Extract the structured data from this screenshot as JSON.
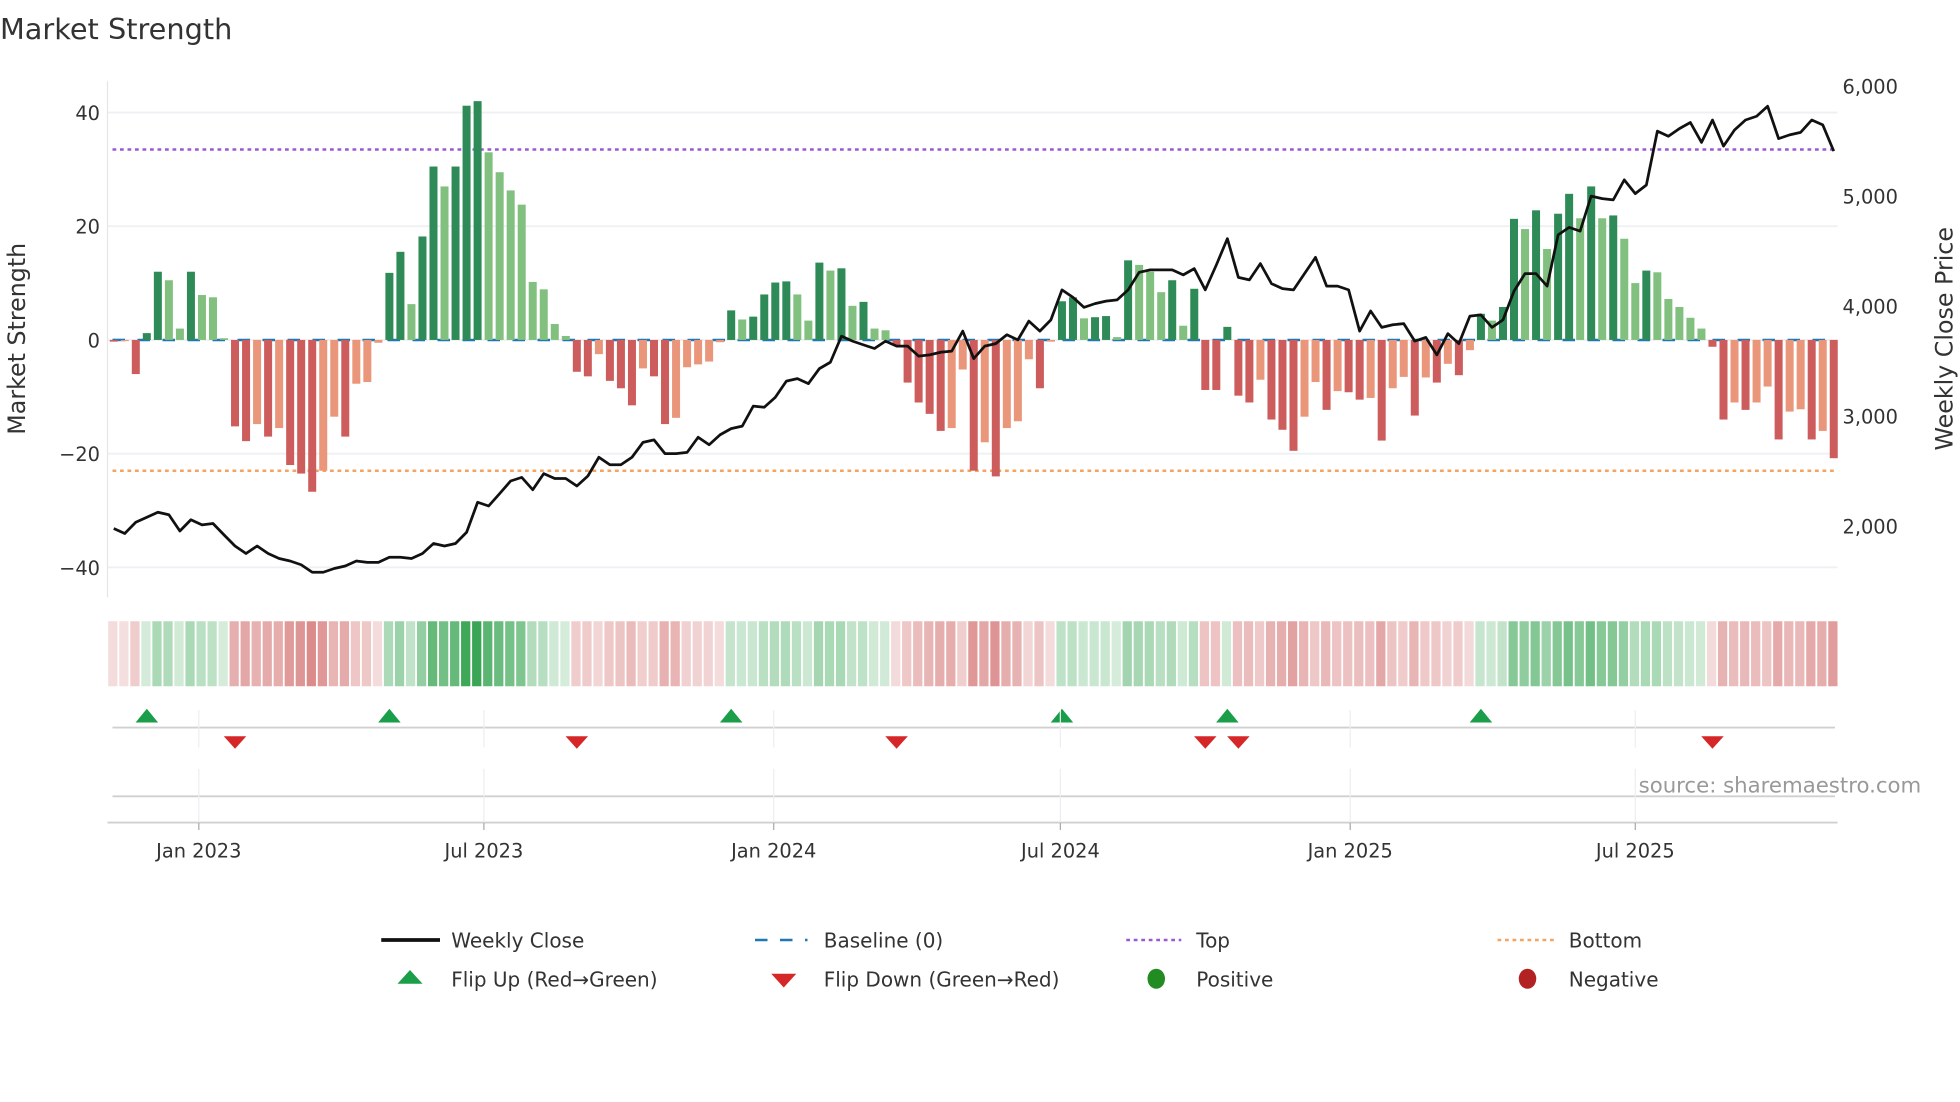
{
  "chart_data": {
    "type": "bar",
    "title": "Market Strength",
    "ylabel": "Market Strength",
    "y2label": "Weekly Close Price",
    "ylim": [
      -45.3,
      45.5
    ],
    "y2lim": [
      1350,
      6045
    ],
    "yticks": [
      40,
      20,
      0,
      -20,
      -40
    ],
    "yticklabels": [
      "40",
      "20",
      "0",
      "−20",
      "−40"
    ],
    "y2ticks": [
      6000,
      5000,
      4000,
      3000,
      2000
    ],
    "y2ticklabels": [
      "6,000",
      "5,000",
      "4,000",
      "3,000",
      "2,000"
    ],
    "x_start": "2022-11-08",
    "x_freq": "weekly",
    "xticks": [
      "2023-01-01",
      "2023-07-01",
      "2024-01-01",
      "2024-07-01",
      "2025-01-01",
      "2025-07-01"
    ],
    "xticklabels": [
      "Jan 2023",
      "Jul 2023",
      "Jan 2024",
      "Jul 2024",
      "Jan 2025",
      "Jul 2025"
    ],
    "top_level": 33.5,
    "bottom_level": -23,
    "baseline": 0,
    "strength": [
      -0.3,
      -0.2,
      -6,
      1.2,
      12,
      10.5,
      2,
      12,
      7.9,
      7.5,
      0.3,
      -15.2,
      -17.8,
      -14.8,
      -17,
      -15.5,
      -22,
      -23.5,
      -26.7,
      -23,
      -13.5,
      -17,
      -7.7,
      -7.4,
      -0.5,
      11.8,
      15.5,
      6.3,
      18.2,
      30.5,
      27,
      30.5,
      41.2,
      42,
      33,
      29.5,
      26.3,
      23.8,
      10.2,
      8.9,
      2.8,
      0.7,
      -5.6,
      -6.4,
      -2.5,
      -7.2,
      -8.5,
      -11.5,
      -5,
      -6.4,
      -14.8,
      -13.7,
      -4.8,
      -4.3,
      -3.8,
      -0.4,
      5.2,
      3.6,
      4.1,
      8,
      10.1,
      10.3,
      8,
      3.4,
      13.6,
      12.2,
      12.6,
      6,
      6.7,
      2,
      1.7,
      -1,
      -7.5,
      -11,
      -13,
      -16,
      -15.5,
      -5.2,
      -23,
      -18,
      -24,
      -15.5,
      -14.3,
      -3.4,
      -8.5,
      -0.3,
      6.8,
      7.5,
      3.8,
      4,
      4.2,
      0.5,
      14,
      13.2,
      12,
      8.4,
      10.5,
      2.5,
      9,
      -8.8,
      -8.8,
      2.3,
      -9.8,
      -11,
      -7,
      -14,
      -15.8,
      -19.5,
      -13.5,
      -7.4,
      -12.3,
      -9,
      -9.2,
      -10.5,
      -10.2,
      -17.7,
      -8.5,
      -6.5,
      -13.3,
      -6.6,
      -7.5,
      -4.2,
      -6.2,
      -1.8,
      4.6,
      3.4,
      5.8,
      21.3,
      19.5,
      22.8,
      16,
      22.2,
      25.7,
      21.4,
      27,
      21.4,
      21.9,
      17.8,
      10,
      12.2,
      11.9,
      7.2,
      5.8,
      3.9,
      2,
      -1.2,
      -14,
      -11,
      -12.3,
      -11,
      -8.2,
      -17.5,
      -12.6,
      -12.2,
      -17.5,
      -16,
      -20.8
    ],
    "weekly_close": [
      1977,
      1932,
      2034,
      2080,
      2125,
      2102,
      1955,
      2057,
      2011,
      2023,
      1920,
      1818,
      1750,
      1818,
      1750,
      1705,
      1682,
      1648,
      1580,
      1580,
      1614,
      1636,
      1682,
      1670,
      1670,
      1716,
      1716,
      1705,
      1750,
      1841,
      1818,
      1841,
      1943,
      2216,
      2182,
      2295,
      2409,
      2443,
      2330,
      2477,
      2432,
      2432,
      2364,
      2455,
      2625,
      2557,
      2557,
      2625,
      2761,
      2784,
      2659,
      2659,
      2670,
      2807,
      2739,
      2830,
      2886,
      2909,
      3091,
      3080,
      3170,
      3318,
      3341,
      3295,
      3432,
      3489,
      3727,
      3682,
      3648,
      3614,
      3682,
      3636,
      3636,
      3545,
      3557,
      3580,
      3591,
      3773,
      3523,
      3636,
      3659,
      3739,
      3693,
      3864,
      3773,
      3875,
      4148,
      4080,
      3989,
      4023,
      4045,
      4057,
      4148,
      4307,
      4330,
      4330,
      4330,
      4284,
      4341,
      4148,
      4375,
      4614,
      4261,
      4239,
      4386,
      4205,
      4159,
      4148,
      4295,
      4443,
      4182,
      4182,
      4148,
      3773,
      3955,
      3807,
      3830,
      3841,
      3682,
      3716,
      3557,
      3750,
      3659,
      3909,
      3920,
      3807,
      3875,
      4136,
      4295,
      4295,
      4182,
      4648,
      4716,
      4682,
      5000,
      4977,
      4966,
      5148,
      5023,
      5102,
      5591,
      5545,
      5614,
      5670,
      5489,
      5693,
      5455,
      5602,
      5693,
      5727,
      5818,
      5523,
      5557,
      5580,
      5693,
      5648,
      5409
    ],
    "flip_up_weeks": [
      3,
      25,
      56,
      86,
      101,
      124
    ],
    "flip_down_weeks": [
      11,
      42,
      71,
      99,
      102,
      145
    ],
    "legend": {
      "placement": "bottom",
      "items": [
        {
          "label": "Weekly Close"
        },
        {
          "label": "Baseline (0)"
        },
        {
          "label": "Top"
        },
        {
          "label": "Bottom"
        },
        {
          "label": "Flip Up (Red→Green)"
        },
        {
          "label": "Flip Down (Green→Red)"
        },
        {
          "label": "Positive"
        },
        {
          "label": "Negative"
        }
      ]
    },
    "source": "source: sharemaestro.com"
  },
  "colors": {
    "pos_strong": "#2e8b57",
    "pos_weak": "#82c07f",
    "neg_strong": "#cd5c5c",
    "neg_weak": "#e9967a",
    "close": "#111111",
    "baseline": "#1f77b4",
    "top": "#9b59d0",
    "bottom": "#f4a460",
    "flip_up": "#1a9e4a",
    "flip_down": "#d62728",
    "positive_dot": "#228b22",
    "negative_dot": "#b22222"
  }
}
